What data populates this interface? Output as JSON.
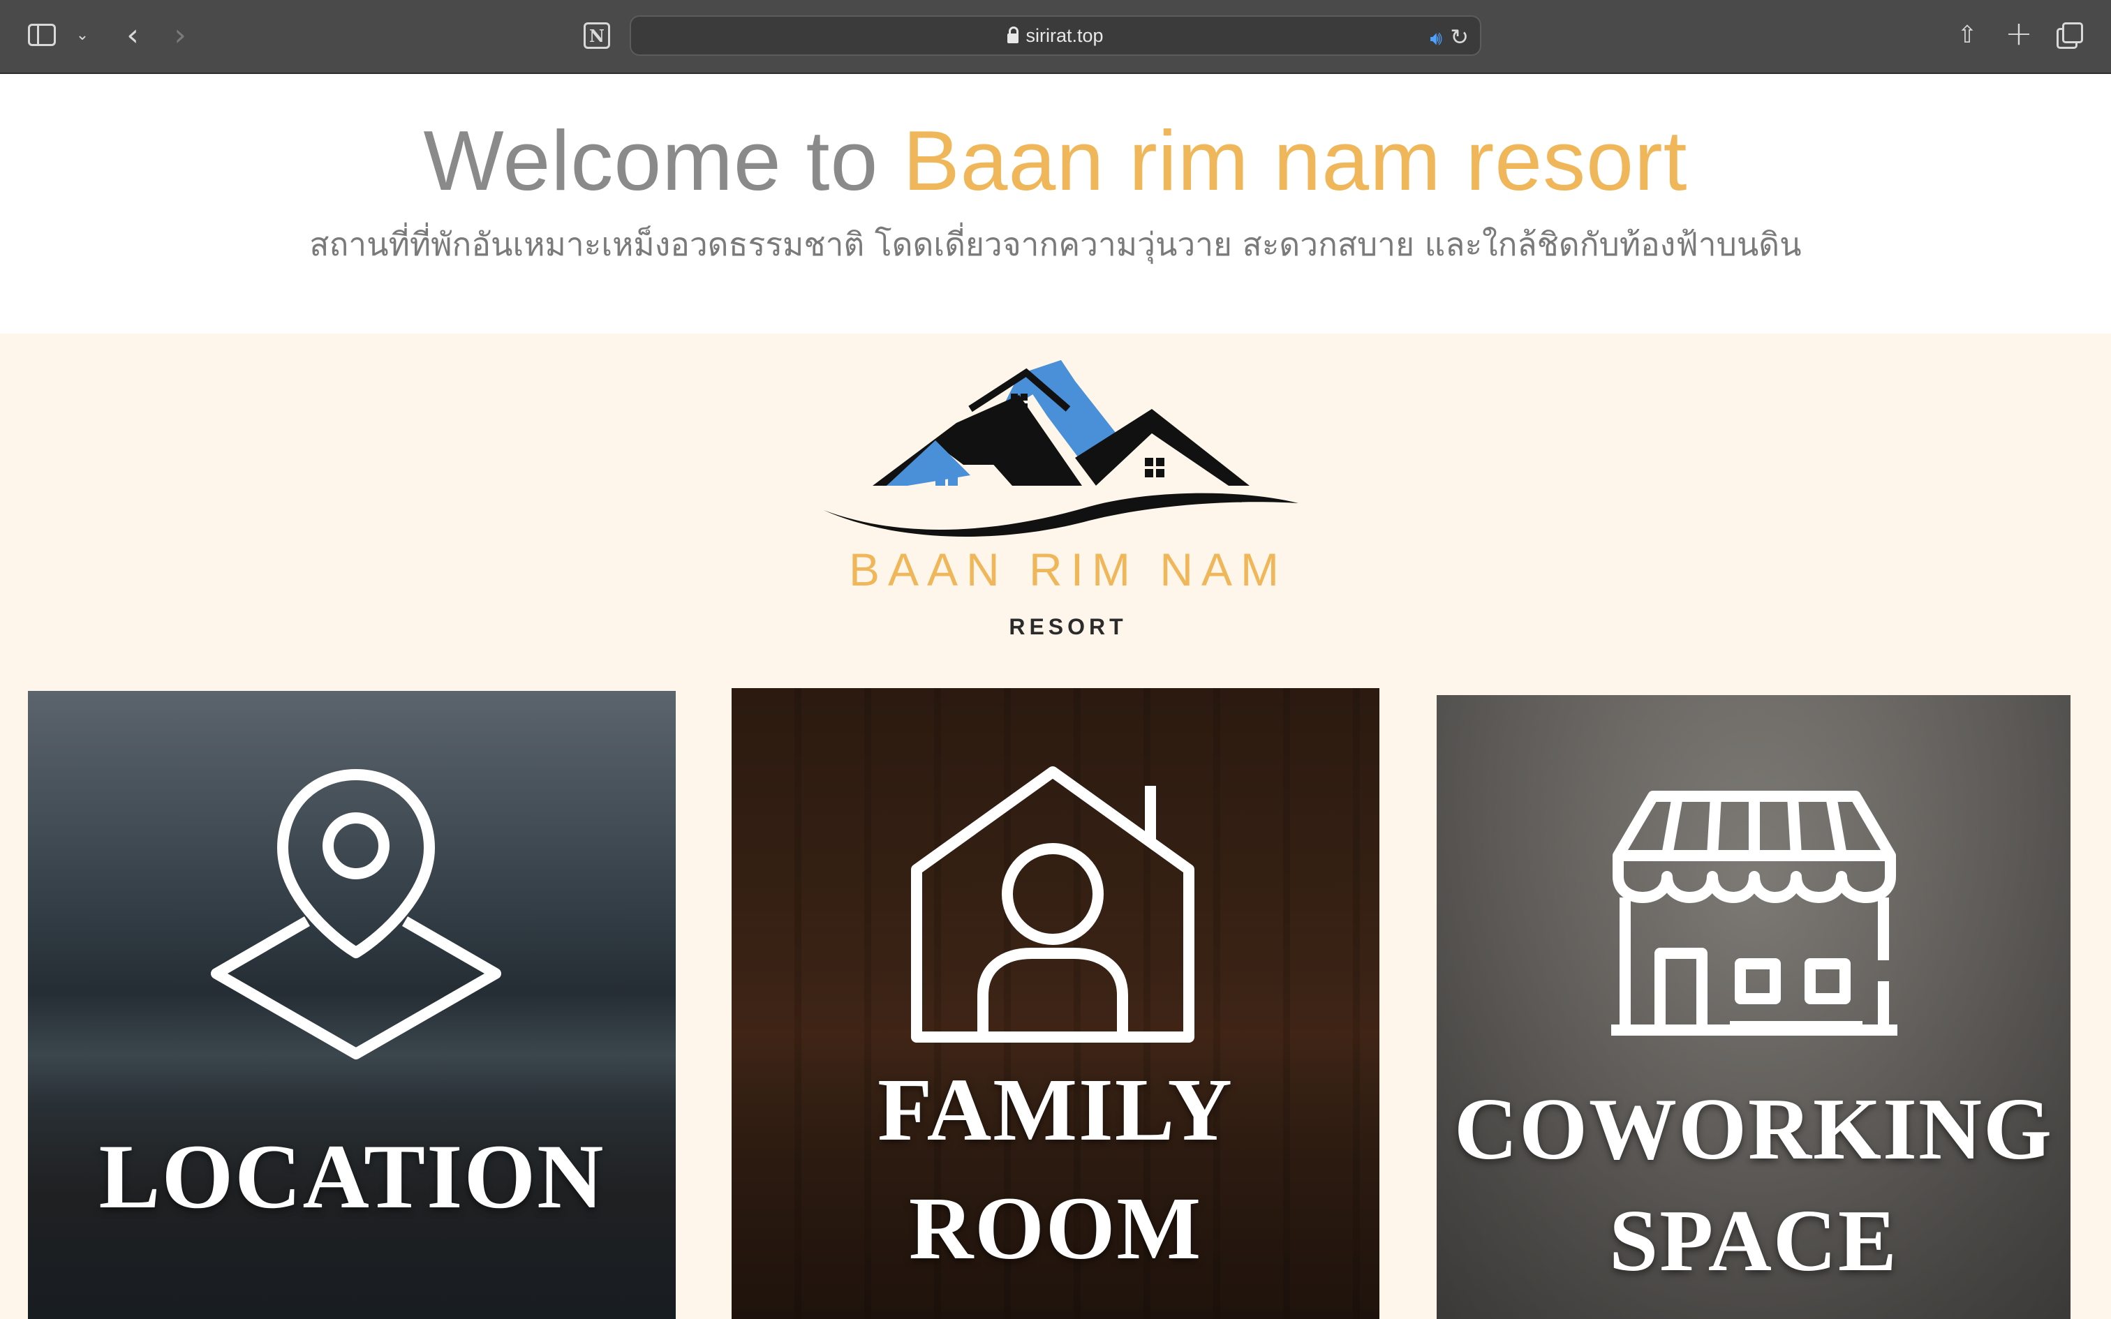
{
  "browser": {
    "url": "sirirat.top",
    "icons": {
      "sidebar": "sidebar-icon",
      "chevron": "chevron-down-icon",
      "back": "back-arrow-icon",
      "forward": "forward-arrow-icon",
      "notion": "notion-icon",
      "lock": "lock-icon",
      "speaker": "speaker-icon",
      "reload": "reload-icon",
      "share": "share-icon",
      "new_tab": "plus-icon",
      "tabs": "tabs-overview-icon"
    }
  },
  "hero": {
    "welcome_prefix": "Welcome to",
    "brand_name": "Baan rim nam resort",
    "subtitle": "สถานที่ที่พักอันเหมาะเหม็งอวดธรรมชาติ โดดเดี่ยวจากความวุ่นวาย สะดวกสบาย และใกล้ชิดกับท้องฟ้าบนดิน"
  },
  "logo": {
    "name": "BAAN RIM NAM",
    "sub": "RESORT"
  },
  "cards": [
    {
      "label_line1": "LOCATION",
      "label_line2": "",
      "icon": "location-pin-icon"
    },
    {
      "label_line1": "FAMILY",
      "label_line2": "ROOM",
      "icon": "house-person-icon"
    },
    {
      "label_line1": "COWORKING",
      "label_line2": "SPACE",
      "icon": "storefront-icon"
    }
  ],
  "colors": {
    "accent": "#f0b75a",
    "heading_grey": "#8a8a8a",
    "cream": "#fef6ea",
    "roof_blue": "#4a90d9"
  }
}
